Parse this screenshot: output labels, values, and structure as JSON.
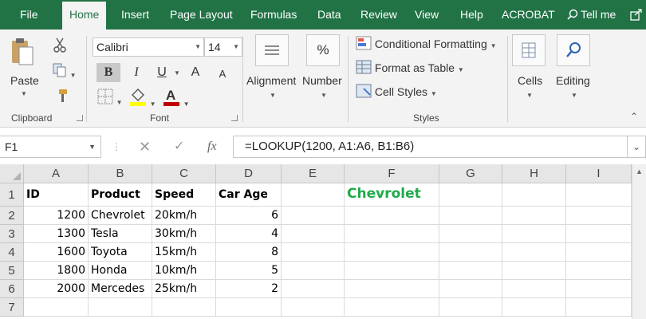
{
  "tabs": [
    "File",
    "Home",
    "Insert",
    "Page Layout",
    "Formulas",
    "Data",
    "Review",
    "View",
    "Help",
    "ACROBAT"
  ],
  "active_tab": "Home",
  "tell_me": "Tell me",
  "ribbon": {
    "clipboard": {
      "paste_label": "Paste",
      "group_label": "Clipboard"
    },
    "font": {
      "font_name": "Calibri",
      "font_size": "14",
      "bold": "B",
      "italic": "I",
      "underline": "U",
      "grow": "A",
      "shrink": "A",
      "group_label": "Font"
    },
    "alignment_label": "Alignment",
    "number_label": "Number",
    "number_symbol": "%",
    "styles": {
      "conditional_formatting": "Conditional Formatting",
      "format_as_table": "Format as Table",
      "cell_styles": "Cell Styles",
      "group_label": "Styles"
    },
    "cells_label": "Cells",
    "editing_label": "Editing"
  },
  "formula_bar": {
    "name_box": "F1",
    "fx": "fx",
    "formula": "=LOOKUP(1200, A1:A6, B1:B6)"
  },
  "grid": {
    "columns": [
      "A",
      "B",
      "C",
      "D",
      "E",
      "F",
      "G",
      "H",
      "I"
    ],
    "rows": [
      "1",
      "2",
      "3",
      "4",
      "5",
      "6",
      "7"
    ],
    "header_row": [
      "ID",
      "Product",
      "Speed",
      "Car Age"
    ],
    "data_rows": [
      [
        "1200",
        "Chevrolet",
        "20km/h",
        "6"
      ],
      [
        "1300",
        "Tesla",
        "30km/h",
        "4"
      ],
      [
        "1600",
        "Toyota",
        "15km/h",
        "8"
      ],
      [
        "1800",
        "Honda",
        "10km/h",
        "5"
      ],
      [
        "2000",
        "Mercedes",
        "25km/h",
        "2"
      ]
    ],
    "result_cell": "Chevrolet"
  },
  "colors": {
    "excel_green": "#217346",
    "result_green": "#1faa4a",
    "underline_red": "#c00000",
    "highlight_yellow": "#ffff00"
  }
}
